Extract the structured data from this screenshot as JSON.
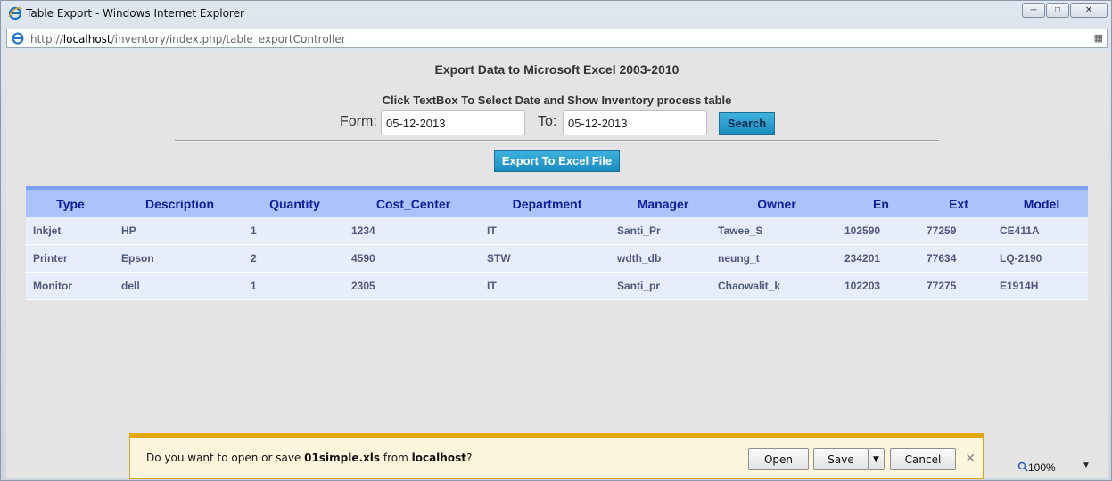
{
  "window": {
    "title": "Table Export - Windows Internet Explorer",
    "url_prefix": "http://",
    "url_host": "localhost",
    "url_path": "/inventory/index.php/table_exportController"
  },
  "page": {
    "heading": "Export Data to Microsoft Excel 2003-2010",
    "subheading": "Click TextBox To Select Date and Show Inventory process table",
    "from_label": "Form:",
    "from_value": "05-12-2013",
    "to_label": "To:",
    "to_value": "05-12-2013",
    "search_label": "Search",
    "export_label": "Export To Excel File"
  },
  "table": {
    "columns": [
      "Type",
      "Description",
      "Quantity",
      "Cost_Center",
      "Department",
      "Manager",
      "Owner",
      "En",
      "Ext",
      "Model"
    ],
    "rows": [
      [
        "Inkjet",
        "HP",
        "1",
        "1234",
        "IT",
        "Santi_Pr",
        "Tawee_S",
        "102590",
        "77259",
        "CE411A"
      ],
      [
        "Printer",
        "Epson",
        "2",
        "4590",
        "STW",
        "wdth_db",
        "neung_t",
        "234201",
        "77634",
        "LQ-2190"
      ],
      [
        "Monitor",
        "dell",
        "1",
        "2305",
        "IT",
        "Santi_pr",
        "Chaowalit_k",
        "102203",
        "77275",
        "E1914H"
      ]
    ]
  },
  "download_bar": {
    "prefix": "Do you want to open or save ",
    "filename": "01simple.xls",
    "middle": " from ",
    "source": "localhost",
    "suffix": "?",
    "open_label": "Open",
    "save_label": "Save",
    "cancel_label": "Cancel"
  },
  "status": {
    "zoom": "100%"
  },
  "colors": {
    "header_bg": "#aac4fa",
    "header_text": "#0f1f9c",
    "row_bg": "#e8edfc",
    "button_blue": "#1a8cc0",
    "infobar_bg": "#fdf6dc"
  }
}
